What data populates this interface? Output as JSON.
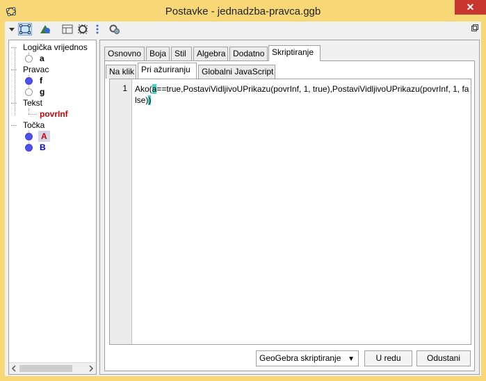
{
  "window": {
    "title": "Postavke - jednadzba-pravca.ggb",
    "close_label": "✕"
  },
  "toolbar": {
    "icons": [
      "select-objects-icon",
      "graphics-icon",
      "layout-icon",
      "settings-icon",
      "more-icon",
      "tools-icon"
    ]
  },
  "tree": {
    "groups": [
      {
        "label": "Logička vrijednos",
        "items": [
          {
            "label": "a",
            "color": "#000000",
            "dot": "empty"
          }
        ]
      },
      {
        "label": "Pravac",
        "items": [
          {
            "label": "f",
            "color": "#000000",
            "dot": "blue"
          },
          {
            "label": "g",
            "color": "#000000",
            "dot": "empty"
          }
        ]
      },
      {
        "label": "Tekst",
        "items": [
          {
            "label": "povrInf",
            "color": "#cc0000",
            "dot": "none"
          }
        ]
      },
      {
        "label": "Točka",
        "items": [
          {
            "label": "A",
            "color": "#cc0000",
            "dot": "blue",
            "selected": true
          },
          {
            "label": "B",
            "color": "#0000cc",
            "dot": "blue"
          }
        ]
      }
    ]
  },
  "tabs": {
    "main": [
      "Osnovno",
      "Boja",
      "Stil",
      "Algebra",
      "Dodatno",
      "Skriptiranje"
    ],
    "main_selected": "Skriptiranje",
    "sub": [
      "Na klik",
      "Pri ažuriranju",
      "Globalni JavaScript"
    ],
    "sub_selected": "Pri ažuriranju"
  },
  "editor": {
    "line_number": "1",
    "code_before": "Ako(",
    "code_caret": "a",
    "code_after": "==true,PostaviVidljivoUPrikazu(povrInf, 1, true),PostaviVidljivoUPrikazu(povrInf, 1, false)",
    "code_end_caret": ")"
  },
  "footer": {
    "script_type": "GeoGebra skriptiranje",
    "ok_label": "U redu",
    "cancel_label": "Odustani"
  }
}
